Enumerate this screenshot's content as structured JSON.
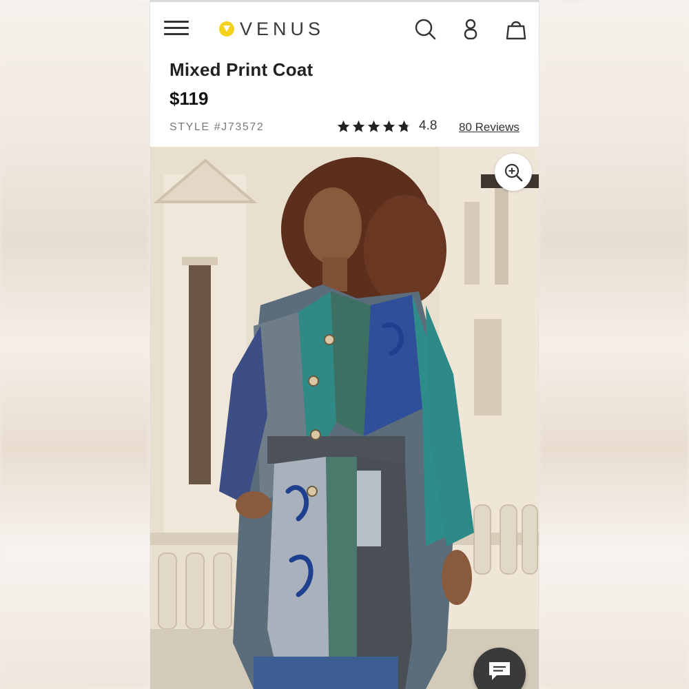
{
  "header": {
    "logo_text": "VENUS",
    "icons": [
      "menu-icon",
      "search-icon",
      "account-icon",
      "shopping-bag-icon"
    ]
  },
  "product": {
    "title": "Mixed Print Coat",
    "price": "$119",
    "style": "STYLE #J73572",
    "rating": 4.8,
    "rating_text": "4.8",
    "reviews_link": "80 Reviews"
  },
  "image": {
    "alt": "Model wearing a mixed print patchwork coat in teal, blue and grey",
    "zoom_icon": "zoom-in-icon"
  },
  "chat": {
    "icon": "chat-icon"
  },
  "colors": {
    "logo_accent": "#f4d11a",
    "text_dark": "#222222",
    "muted": "#7a7a7a"
  }
}
